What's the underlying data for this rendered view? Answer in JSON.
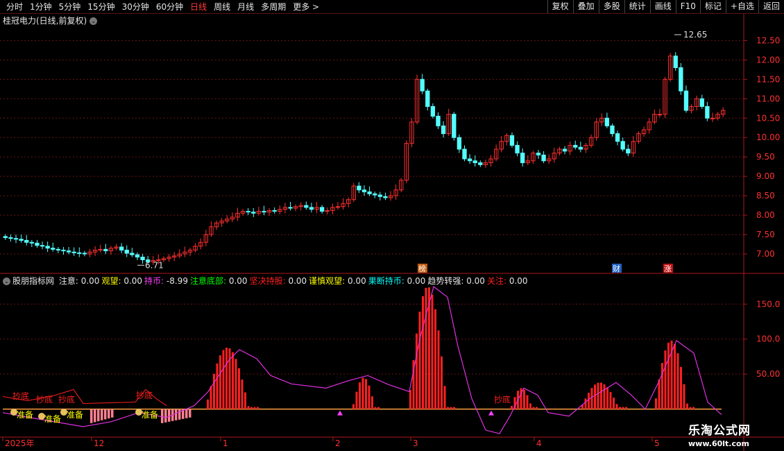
{
  "toolbar": {
    "left": [
      {
        "label": "分时",
        "active": false
      },
      {
        "label": "1分钟",
        "active": false
      },
      {
        "label": "5分钟",
        "active": false
      },
      {
        "label": "15分钟",
        "active": false
      },
      {
        "label": "30分钟",
        "active": false
      },
      {
        "label": "60分钟",
        "active": false
      },
      {
        "label": "日线",
        "active": true
      },
      {
        "label": "周线",
        "active": false
      },
      {
        "label": "月线",
        "active": false
      },
      {
        "label": "多周期",
        "active": false
      },
      {
        "label": "更多 >",
        "active": false
      }
    ],
    "right": [
      "复权",
      "叠加",
      "多股",
      "统计",
      "画线",
      "F10",
      "标记",
      "+自选",
      "返回"
    ]
  },
  "stock_title": "桂冠电力(日线,前复权)",
  "price_axis": [
    "12.50",
    "12.00",
    "11.50",
    "11.00",
    "10.50",
    "10.00",
    "9.50",
    "9.00",
    "8.50",
    "8.00",
    "7.50",
    "7.00"
  ],
  "high_label": "12.65",
  "low_label": "6.71",
  "event_tags": [
    "榜",
    "财",
    "涨"
  ],
  "indicator": {
    "name": "股朋指标网",
    "items": [
      {
        "label": "注意:",
        "value": "0.00",
        "color": "#e6e6e6"
      },
      {
        "label": "观望:",
        "value": "0.00",
        "color": "#ffff00"
      },
      {
        "label": "持币:",
        "value": "-8.99",
        "color": "#ff40ff"
      },
      {
        "label": "注意底部:",
        "value": "0.00",
        "color": "#00ff00"
      },
      {
        "label": "坚决持股:",
        "value": "0.00",
        "color": "#ff2020"
      },
      {
        "label": "谨慎观望:",
        "value": "0.00",
        "color": "#ffff00"
      },
      {
        "label": "果断持币:",
        "value": "0.00",
        "color": "#00ffff"
      },
      {
        "label": "趋势转强:",
        "value": "0.00",
        "color": "#e6e6e6"
      },
      {
        "label": "关注:",
        "value": "0.00",
        "color": "#ff2020"
      }
    ]
  },
  "indicator_axis": [
    "150.0",
    "100.0",
    "50.00"
  ],
  "signal_labels": {
    "chaodi": "抄底",
    "zhunbei": "准备"
  },
  "date_axis": [
    "2025年",
    "12",
    "1",
    "2",
    "3",
    "4",
    "5"
  ],
  "watermark": {
    "title": "乐淘公式网",
    "url": "www.60lt.com"
  },
  "colors": {
    "up": "#ff3030",
    "down": "#54ffff",
    "grid": "#6a1414",
    "axis": "#b01818"
  },
  "chart_data": {
    "type": "candlestick",
    "title": "桂冠电力(日线,前复权)",
    "ylim": [
      6.5,
      12.9
    ],
    "high": 12.65,
    "low": 6.71,
    "indicator_ylim": [
      -40,
      180
    ]
  }
}
